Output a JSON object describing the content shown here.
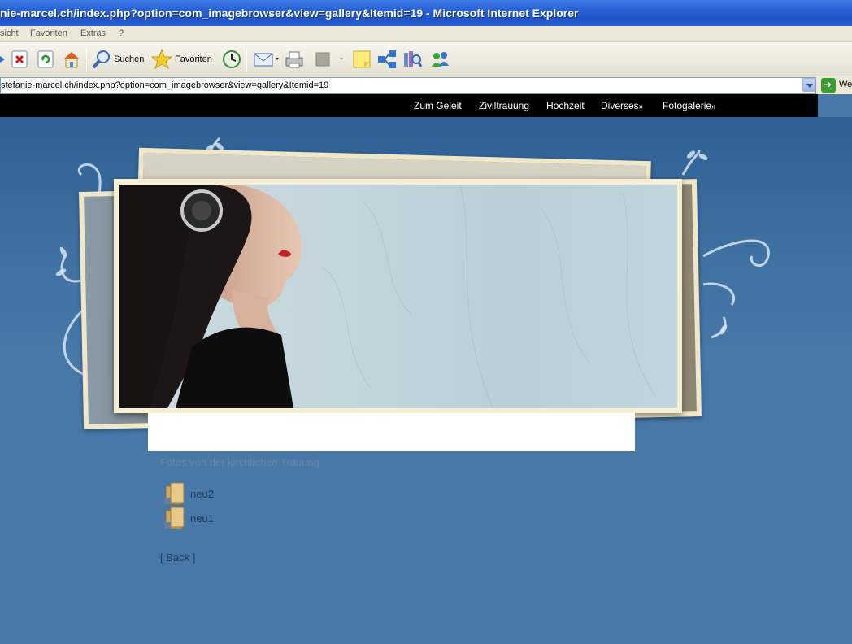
{
  "window": {
    "title": "nie-marcel.ch/index.php?option=com_imagebrowser&view=gallery&Itemid=19 - Microsoft Internet Explorer"
  },
  "menu": [
    "sicht",
    "Favoriten",
    "Extras",
    "?"
  ],
  "toolbar": {
    "search_label": "Suchen",
    "favorites_label": "Favoriten"
  },
  "address": {
    "url": "stefanie-marcel.ch/index.php?option=com_imagebrowser&view=gallery&Itemid=19",
    "go_label": "We"
  },
  "nav": {
    "items": [
      {
        "label": "Zum Geleit",
        "suffix": ""
      },
      {
        "label": "Ziviltrauung",
        "suffix": ""
      },
      {
        "label": "Hochzeit",
        "suffix": ""
      },
      {
        "label": "Diverses",
        "suffix": "»"
      },
      {
        "label": "Fotogalerie",
        "suffix": "»"
      }
    ]
  },
  "gallery": {
    "heading": "Fotos von der kirchlichen Trauung",
    "folders": [
      {
        "label": "neu2"
      },
      {
        "label": "neu1"
      }
    ],
    "back_label": "[ Back ]"
  }
}
